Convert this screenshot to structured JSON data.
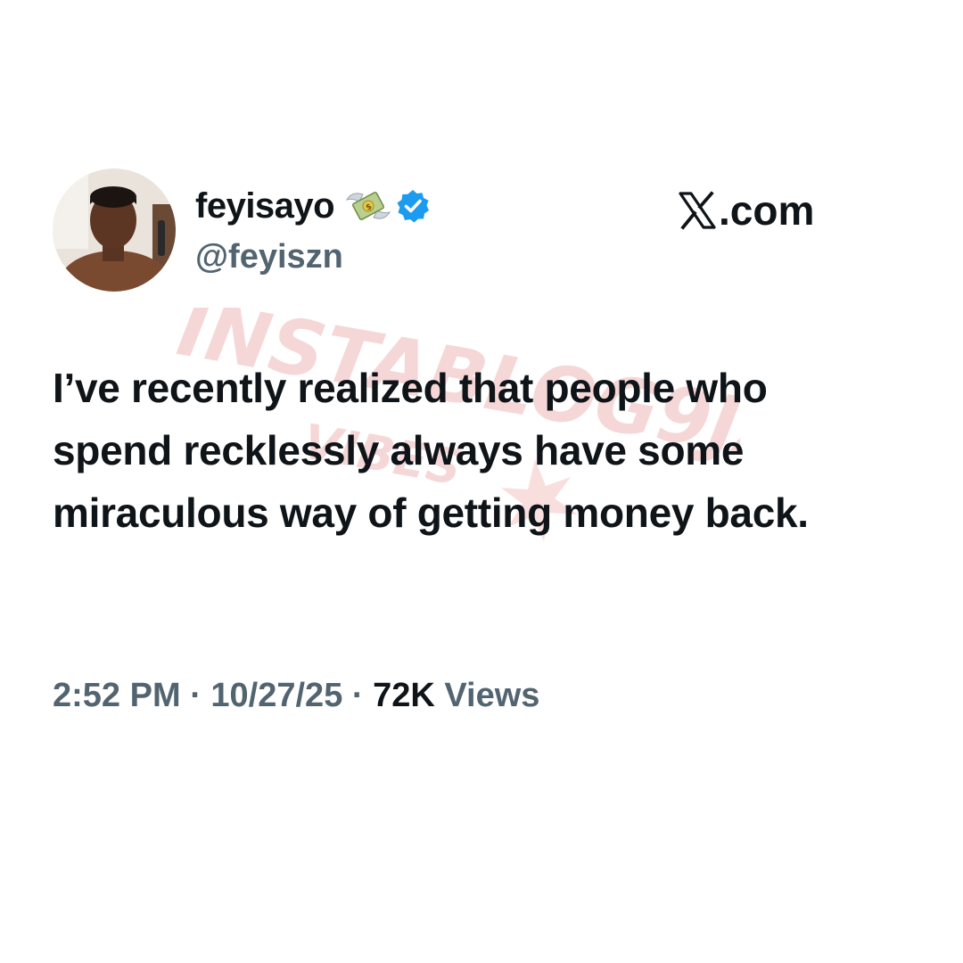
{
  "author": {
    "display_name": "feyisayo",
    "handle": "@feyiszn",
    "name_emoji": "money-with-wings-icon",
    "verified_badge": "verified-badge-icon",
    "verified_color": "#1d9bf0"
  },
  "source": {
    "label": ".com",
    "logo": "x-logo-icon"
  },
  "tweet": {
    "text": "I’ve recently realized that people who spend recklessly always have some miraculous way of getting money back."
  },
  "meta": {
    "time": "2:52 PM",
    "separator": "·",
    "date": "10/27/25",
    "view_count": "72K",
    "views_label": "Views"
  },
  "watermark": {
    "brand": "INSTABLOG9JA",
    "tagline": "VIBES",
    "color": "#f3c6c6"
  },
  "colors": {
    "primary_text": "#0f1419",
    "secondary_text": "#536471",
    "background": "#ffffff"
  }
}
